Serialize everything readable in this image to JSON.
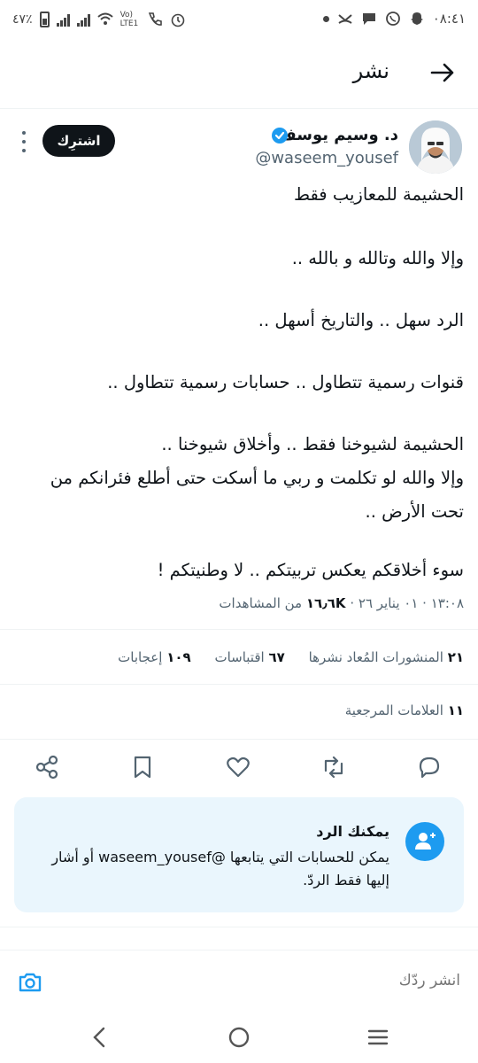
{
  "status_bar": {
    "time": "٠٨:٤١",
    "battery": "٤٧٪",
    "network": "Vo) LTE1"
  },
  "header": {
    "title": "نشر"
  },
  "tweet": {
    "author_name": "د. وسيم يوسف",
    "handle": "@waseem_yousef",
    "subscribe_label": "اشترِك",
    "lines": [
      "الحشيمة للمعازيب فقط",
      "وإلا والله وتالله و بالله ..",
      "الرد سهل .. والتاريخ أسهل ..",
      "قنوات رسمية تتطاول .. حسابات رسمية تتطاول ..",
      "الحشيمة لشيوخنا فقط .. وأخلاق شيوخنا ..",
      "وإلا والله لو تكلمت و ربي ما أسكت حتى أطلع فئرانكم من",
      "تحت الأرض ..",
      "سوء أخلاقكم يعكس تربيتكم .. لا وطنيتكم !"
    ],
    "timestamp": "١٣:٠٨ ‏· ٠١ يناير ٢٦ ·",
    "views_count": "‏١٦٫٦K",
    "views_label": "من المشاهدات"
  },
  "stats": {
    "reposts_count": "٢١",
    "reposts_label": "المنشورات المُعاد نشرها",
    "quotes_count": "٦٧",
    "quotes_label": "اقتباسات",
    "likes_count": "١٠٩",
    "likes_label": "إعجابات",
    "bookmarks_count": "١١",
    "bookmarks_label": "العلامات المرجعية"
  },
  "actions": [
    "reply-icon",
    "repost-icon",
    "like-icon",
    "bookmark-icon",
    "share-icon"
  ],
  "reply_notice": {
    "title": "يمكنك الرد",
    "body": "يمكن للحسابات التي يتابعها @waseem_yousef أو أشار إليها فقط الردّ."
  },
  "compose": {
    "placeholder": "انشر ردّك"
  },
  "colors": {
    "accent": "#1d9bf0",
    "text": "#0f1419",
    "muted": "#536471",
    "notice_bg": "#eaf6fd"
  }
}
